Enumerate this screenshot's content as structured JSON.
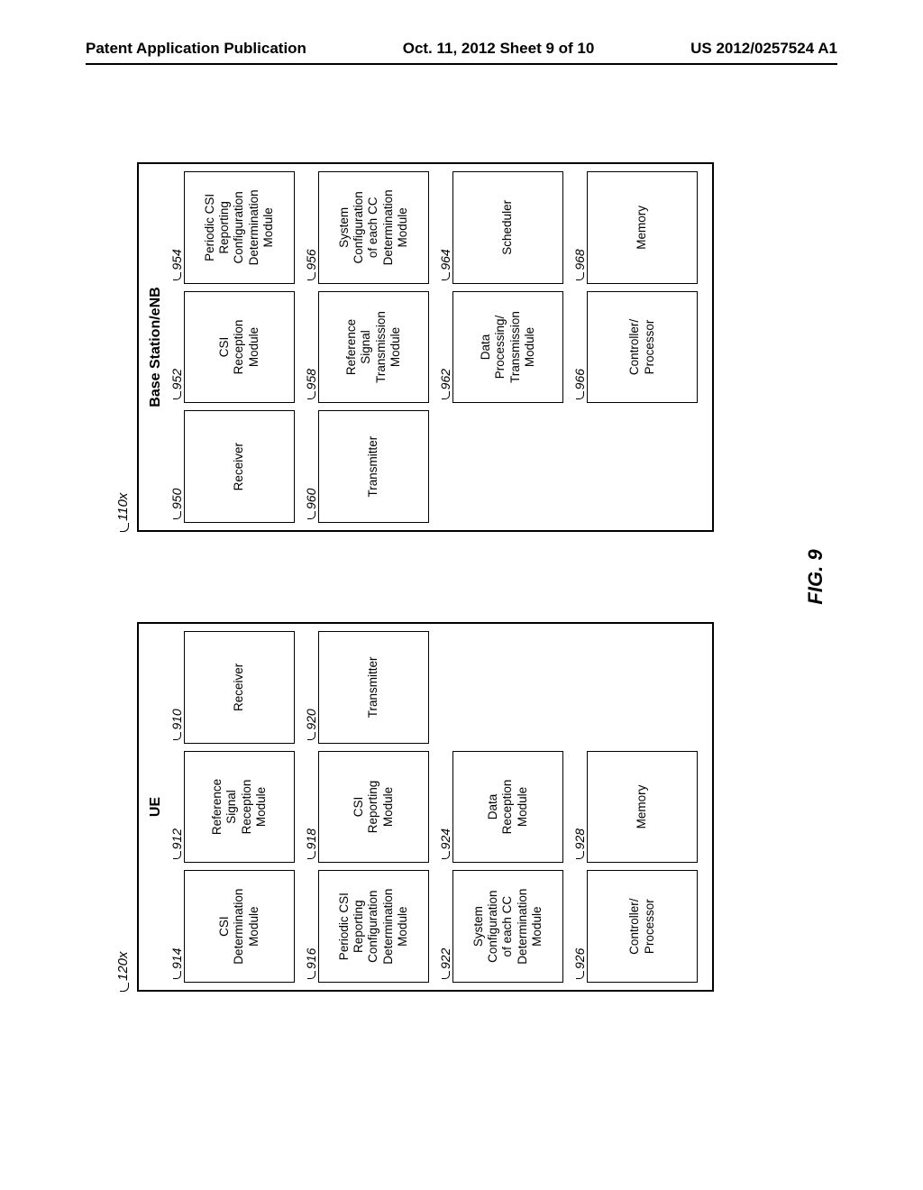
{
  "header": {
    "left": "Patent Application Publication",
    "center": "Oct. 11, 2012  Sheet 9 of 10",
    "right": "US 2012/0257524 A1"
  },
  "figure_caption": "FIG. 9",
  "ue": {
    "ref": "120x",
    "title": "UE",
    "col_left": [
      {
        "ref": "914",
        "label": "CSI\nDetermination\nModule"
      },
      {
        "ref": "916",
        "label": "Periodic CSI\nReporting\nConfiguration\nDetermination\nModule"
      },
      {
        "ref": "922",
        "label": "System\nConfiguration\nof each CC\nDetermination\nModule"
      },
      {
        "ref": "926",
        "label": "Controller/\nProcessor"
      }
    ],
    "col_mid": [
      {
        "ref": "912",
        "label": "Reference\nSignal\nReception\nModule"
      },
      {
        "ref": "918",
        "label": "CSI\nReporting\nModule"
      },
      {
        "ref": "924",
        "label": "Data\nReception\nModule"
      },
      {
        "ref": "928",
        "label": "Memory"
      }
    ],
    "col_right": [
      {
        "ref": "910",
        "label": "Receiver"
      },
      {
        "ref": "920",
        "label": "Transmitter"
      }
    ]
  },
  "enb": {
    "ref": "110x",
    "title": "Base Station/eNB",
    "col_left": [
      {
        "ref": "950",
        "label": "Receiver"
      },
      {
        "ref": "960",
        "label": "Transmitter"
      }
    ],
    "col_mid": [
      {
        "ref": "952",
        "label": "CSI\nReception\nModule"
      },
      {
        "ref": "958",
        "label": "Reference\nSignal\nTransmission\nModule"
      },
      {
        "ref": "962",
        "label": "Data\nProcessing/\nTransmission\nModule"
      },
      {
        "ref": "966",
        "label": "Controller/\nProcessor"
      }
    ],
    "col_right": [
      {
        "ref": "954",
        "label": "Periodic CSI\nReporting\nConfiguration\nDetermination\nModule"
      },
      {
        "ref": "956",
        "label": "System\nConfiguration\nof each CC\nDetermination\nModule"
      },
      {
        "ref": "964",
        "label": "Scheduler"
      },
      {
        "ref": "968",
        "label": "Memory"
      }
    ]
  }
}
